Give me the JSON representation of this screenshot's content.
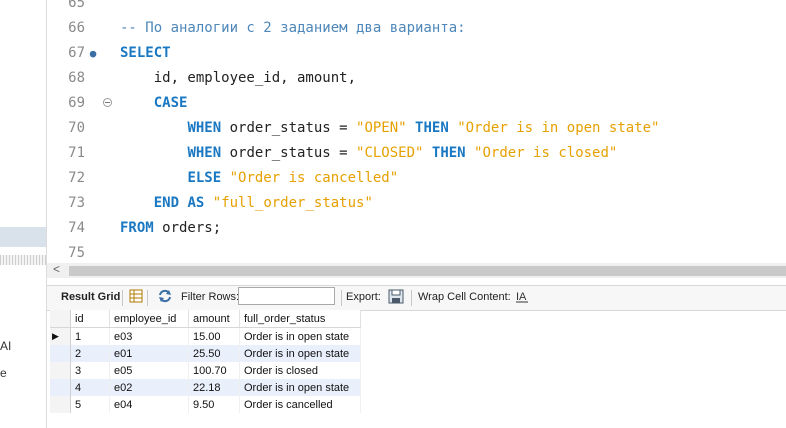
{
  "sidebar": {
    "text_a": "AI",
    "text_b": "e"
  },
  "editor": {
    "lines": [
      {
        "n": "65",
        "tokens": []
      },
      {
        "n": "66",
        "tokens": [
          {
            "t": "-- По аналогии с 2 заданием два варианта:",
            "c": "cmt"
          }
        ]
      },
      {
        "n": "67",
        "marker": "●",
        "tokens": [
          {
            "t": "SELECT",
            "c": "kw"
          }
        ]
      },
      {
        "n": "68",
        "tokens": [
          {
            "t": "    id, employee_id, amount,",
            "c": ""
          }
        ]
      },
      {
        "n": "69",
        "fold": true,
        "tokens": [
          {
            "t": "    ",
            "c": ""
          },
          {
            "t": "CASE",
            "c": "kw"
          }
        ]
      },
      {
        "n": "70",
        "tokens": [
          {
            "t": "        ",
            "c": ""
          },
          {
            "t": "WHEN",
            "c": "kw"
          },
          {
            "t": " order_status = ",
            "c": ""
          },
          {
            "t": "\"OPEN\"",
            "c": "str"
          },
          {
            "t": " ",
            "c": ""
          },
          {
            "t": "THEN",
            "c": "kw"
          },
          {
            "t": " ",
            "c": ""
          },
          {
            "t": "\"Order is in open state\"",
            "c": "str"
          }
        ]
      },
      {
        "n": "71",
        "tokens": [
          {
            "t": "        ",
            "c": ""
          },
          {
            "t": "WHEN",
            "c": "kw"
          },
          {
            "t": " order_status = ",
            "c": ""
          },
          {
            "t": "\"CLOSED\"",
            "c": "str"
          },
          {
            "t": " ",
            "c": ""
          },
          {
            "t": "THEN",
            "c": "kw"
          },
          {
            "t": " ",
            "c": ""
          },
          {
            "t": "\"Order is closed\"",
            "c": "str"
          }
        ]
      },
      {
        "n": "72",
        "tokens": [
          {
            "t": "        ",
            "c": ""
          },
          {
            "t": "ELSE",
            "c": "kw"
          },
          {
            "t": " ",
            "c": ""
          },
          {
            "t": "\"Order is cancelled\"",
            "c": "str"
          }
        ]
      },
      {
        "n": "73",
        "tokens": [
          {
            "t": "    ",
            "c": ""
          },
          {
            "t": "END",
            "c": "kw"
          },
          {
            "t": " ",
            "c": ""
          },
          {
            "t": "AS",
            "c": "kw"
          },
          {
            "t": " ",
            "c": ""
          },
          {
            "t": "\"full_order_status\"",
            "c": "str"
          }
        ]
      },
      {
        "n": "74",
        "tokens": [
          {
            "t": "FROM",
            "c": "kw"
          },
          {
            "t": " orders;",
            "c": ""
          }
        ]
      },
      {
        "n": "75",
        "tokens": []
      }
    ]
  },
  "toolbar": {
    "result_grid": "Result Grid",
    "filter_label": "Filter Rows:",
    "filter_value": "",
    "export_label": "Export:",
    "wrap_label": "Wrap Cell Content:"
  },
  "grid": {
    "columns": [
      "id",
      "employee_id",
      "amount",
      "full_order_status"
    ],
    "rows": [
      [
        "1",
        "e03",
        "15.00",
        "Order is in open state"
      ],
      [
        "2",
        "e01",
        "25.50",
        "Order is in open state"
      ],
      [
        "3",
        "e05",
        "100.70",
        "Order is closed"
      ],
      [
        "4",
        "e02",
        "22.18",
        "Order is in open state"
      ],
      [
        "5",
        "e04",
        "9.50",
        "Order is cancelled"
      ]
    ],
    "current_row_marker": "▶"
  },
  "colors": {
    "keyword": "#1a78c2",
    "string": "#e6a100",
    "comment": "#4e87b9",
    "row_alt": "#e9f0fb"
  }
}
